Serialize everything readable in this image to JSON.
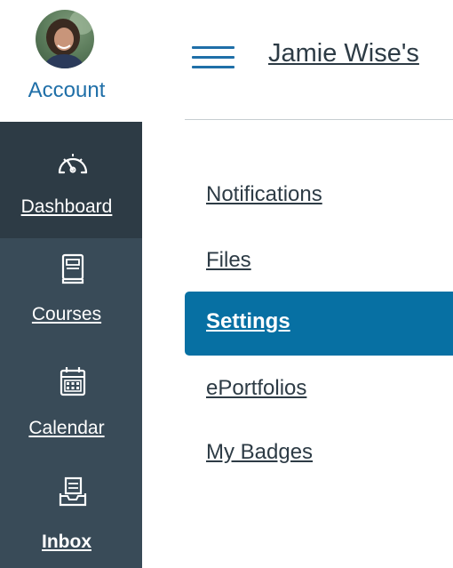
{
  "nav": {
    "account_label": "Account",
    "items": [
      {
        "label": "Dashboard",
        "icon": "dashboard-icon",
        "active": true
      },
      {
        "label": "Courses",
        "icon": "courses-icon"
      },
      {
        "label": "Calendar",
        "icon": "calendar-icon"
      },
      {
        "label": "Inbox",
        "icon": "inbox-icon"
      }
    ]
  },
  "header": {
    "breadcrumb": "Jamie Wise's"
  },
  "subnav": {
    "items": [
      {
        "label": "Notifications"
      },
      {
        "label": "Files"
      },
      {
        "label": "Settings",
        "active": true
      },
      {
        "label": "ePortfolios"
      },
      {
        "label": "My Badges"
      }
    ]
  },
  "colors": {
    "nav_bg": "#394b58",
    "nav_active_bg": "#2d3b45",
    "accent": "#0770a3",
    "link": "#1f6fa8",
    "text": "#2d3b45"
  }
}
